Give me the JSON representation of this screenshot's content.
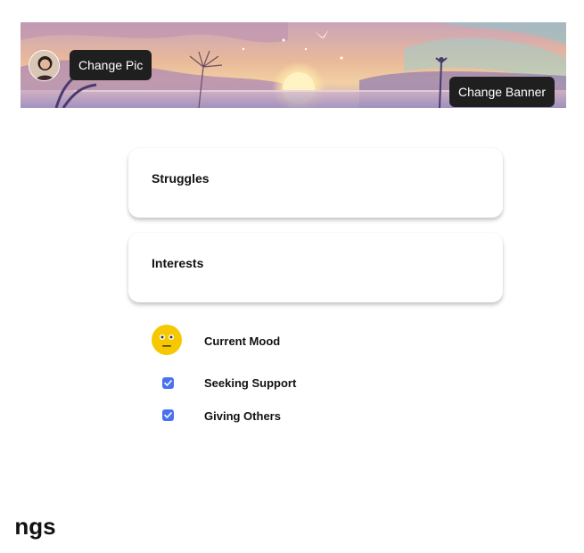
{
  "header": {
    "change_pic_label": "Change Pic",
    "change_banner_label": "Change Banner",
    "avatar_icon": "user-avatar",
    "banner_image": "sunset-landscape-illustration"
  },
  "cards": {
    "struggles_label": "Struggles",
    "interests_label": "Interests"
  },
  "mood": {
    "label": "Current Mood",
    "emoji_icon": "neutral-face-icon"
  },
  "options": {
    "seeking_support": {
      "label": "Seeking Support",
      "checked": true
    },
    "giving_others": {
      "label": "Giving Others",
      "checked": true
    }
  },
  "section": {
    "heading": "ngs"
  },
  "colors": {
    "pill_bg": "#1f1f1f",
    "checkbox": "#4a72f0",
    "emoji": "#f5c800"
  }
}
